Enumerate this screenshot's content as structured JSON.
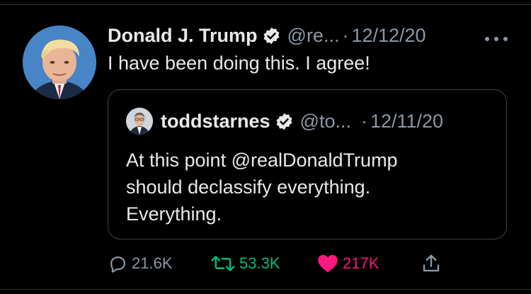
{
  "tweet": {
    "display_name": "Donald J. Trump",
    "handle": "@re...",
    "separator": "·",
    "date": "12/12/20",
    "text": "I have been doing this. I agree!",
    "avatar_icon": "profile-photo",
    "verified_icon": "verified-badge-icon",
    "more_icon": "more-options-icon"
  },
  "quoted_tweet": {
    "display_name": "toddstarnes",
    "handle": "@to...",
    "separator": "·",
    "date": "12/11/20",
    "text": "At this point @realDonaldTrump\nshould declassify everything.\nEverything.",
    "avatar_icon": "profile-photo",
    "verified_icon": "verified-badge-icon"
  },
  "actions": {
    "reply_count": "21.6K",
    "retweet_count": "53.3K",
    "like_count": "217K",
    "reply_icon": "reply-icon",
    "retweet_icon": "retweet-icon",
    "like_icon": "heart-icon",
    "share_icon": "share-icon"
  },
  "colors": {
    "background": "#000000",
    "text": "#e7e9ea",
    "secondary_text": "#8b98a5",
    "retweet_active": "#00ba7c",
    "like_active": "#f91880",
    "border": "#3e4347"
  }
}
